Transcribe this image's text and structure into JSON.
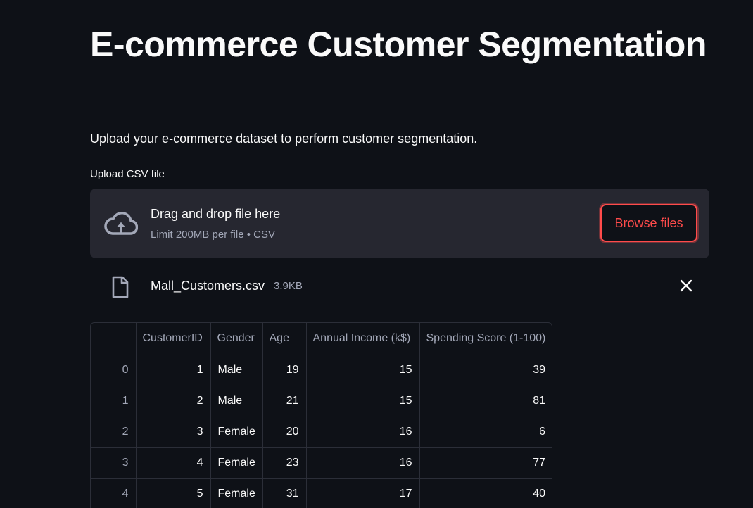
{
  "page": {
    "title": "E-commerce Customer Segmentation",
    "description": "Upload your e-commerce dataset to perform customer segmentation."
  },
  "uploader": {
    "label": "Upload CSV file",
    "drag_text": "Drag and drop file here",
    "limit_text": "Limit 200MB per file • CSV",
    "browse_label": "Browse files",
    "icon": "cloud-upload-icon"
  },
  "uploaded_file": {
    "name": "Mall_Customers.csv",
    "size": "3.9KB",
    "icon": "file-icon",
    "remove_icon": "close-icon"
  },
  "table": {
    "columns": [
      "",
      "CustomerID",
      "Gender",
      "Age",
      "Annual Income (k$)",
      "Spending Score (1-100)"
    ],
    "rows": [
      [
        "0",
        "1",
        "Male",
        "19",
        "15",
        "39"
      ],
      [
        "1",
        "2",
        "Male",
        "21",
        "15",
        "81"
      ],
      [
        "2",
        "3",
        "Female",
        "20",
        "16",
        "6"
      ],
      [
        "3",
        "4",
        "Female",
        "23",
        "16",
        "77"
      ],
      [
        "4",
        "5",
        "Female",
        "31",
        "17",
        "40"
      ]
    ]
  },
  "colors": {
    "background": "#0e1117",
    "surface": "#262730",
    "accent": "#ff4b4b",
    "text": "#fafafa",
    "muted": "#a3a8b8"
  }
}
